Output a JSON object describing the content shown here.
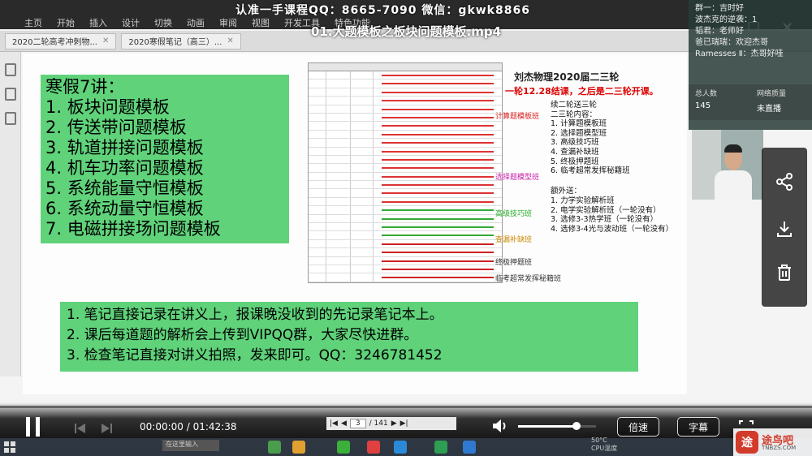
{
  "window": {
    "watermark": "认准一手课程QQ：8665-7090 微信：gkwk8866",
    "video_title": "01.大题模板之板块问题模板.mp4",
    "menu": [
      "主页",
      "开始",
      "插入",
      "设计",
      "切换",
      "动画",
      "审阅",
      "视图",
      "开发工具",
      "特色功能"
    ],
    "tabs": [
      {
        "label": "2020二轮高考冲刺物..."
      },
      {
        "label": "2020寒假笔记（高三）..."
      }
    ]
  },
  "slide": {
    "lesson_box": {
      "heading": "寒假7讲：",
      "items": [
        "1. 板块问题模板",
        "2. 传送带问题模板",
        "3. 轨道拼接问题模板",
        "4. 机车功率问题模板",
        "5. 系统能量守恒模板",
        "6. 系统动量守恒模板",
        "7. 电磁拼接场问题模板"
      ]
    },
    "notes_box": [
      "1. 笔记直接记录在讲义上，报课晚没收到的先记录笔记本上。",
      "2. 课后每道题的解析会上传到VIPQQ群，大家尽快进群。",
      "3. 检查笔记直接对讲义拍照，发来即可。QQ：3246781452"
    ],
    "plan": {
      "title": "刘杰物理2020届二三轮",
      "subtitle": "一轮12.28结课，之后是二三轮开课。",
      "list": [
        "续二轮送三轮",
        "二三轮内容：",
        "1. 计算题模板班",
        "2. 选择题模型班",
        "3. 高级技巧班",
        "4. 查漏补缺班",
        "5. 终极押题班",
        "6. 临考超常发挥秘籍班",
        "",
        "额外送：",
        "1. 力学实验解析班",
        "2. 电学实验解析班（一轮没有）",
        "3. 选修3-3热学班（一轮没有）",
        "4. 选修3-4光与波动班（一轮没有）"
      ],
      "side_labels": [
        {
          "text": "计算题模板班",
          "color": "#d22"
        },
        {
          "text": "选择题模型班",
          "color": "#c2a"
        },
        {
          "text": "高级技巧班",
          "color": "#2a2"
        },
        {
          "text": "查漏补缺班",
          "color": "#c80"
        },
        {
          "text": "终极押题班",
          "color": "#333"
        },
        {
          "text": "临考超常发挥秘籍班",
          "color": "#333"
        }
      ]
    }
  },
  "chat": {
    "messages": [
      "群一：吉时好",
      "波杰克的逆袭：1",
      "韬君：老师好",
      "爸已瑞瑞：欢迎杰哥",
      "Ramesses Ⅱ：杰哥好哇"
    ],
    "stats": [
      {
        "label": "总人数",
        "value": "145"
      },
      {
        "label": "网络质量",
        "value": "未直播"
      }
    ]
  },
  "player": {
    "time": "00:00:00 / 01:42:38",
    "page_current": "3",
    "page_total": "/ 141",
    "progress": 0.0,
    "volume": 0.75,
    "speed_label": "倍速",
    "subtitle_label": "字幕"
  },
  "taskbar": {
    "search_text": "在这里输入",
    "clock": "50°C\nCPU温度"
  },
  "logo": {
    "mark": "途",
    "text": "途鸟吧",
    "url": "TNBZS.COM"
  },
  "icons": [
    "share-icon",
    "download-icon",
    "trash-icon",
    "play-pause-icon",
    "volume-icon",
    "fullscreen-icon"
  ]
}
